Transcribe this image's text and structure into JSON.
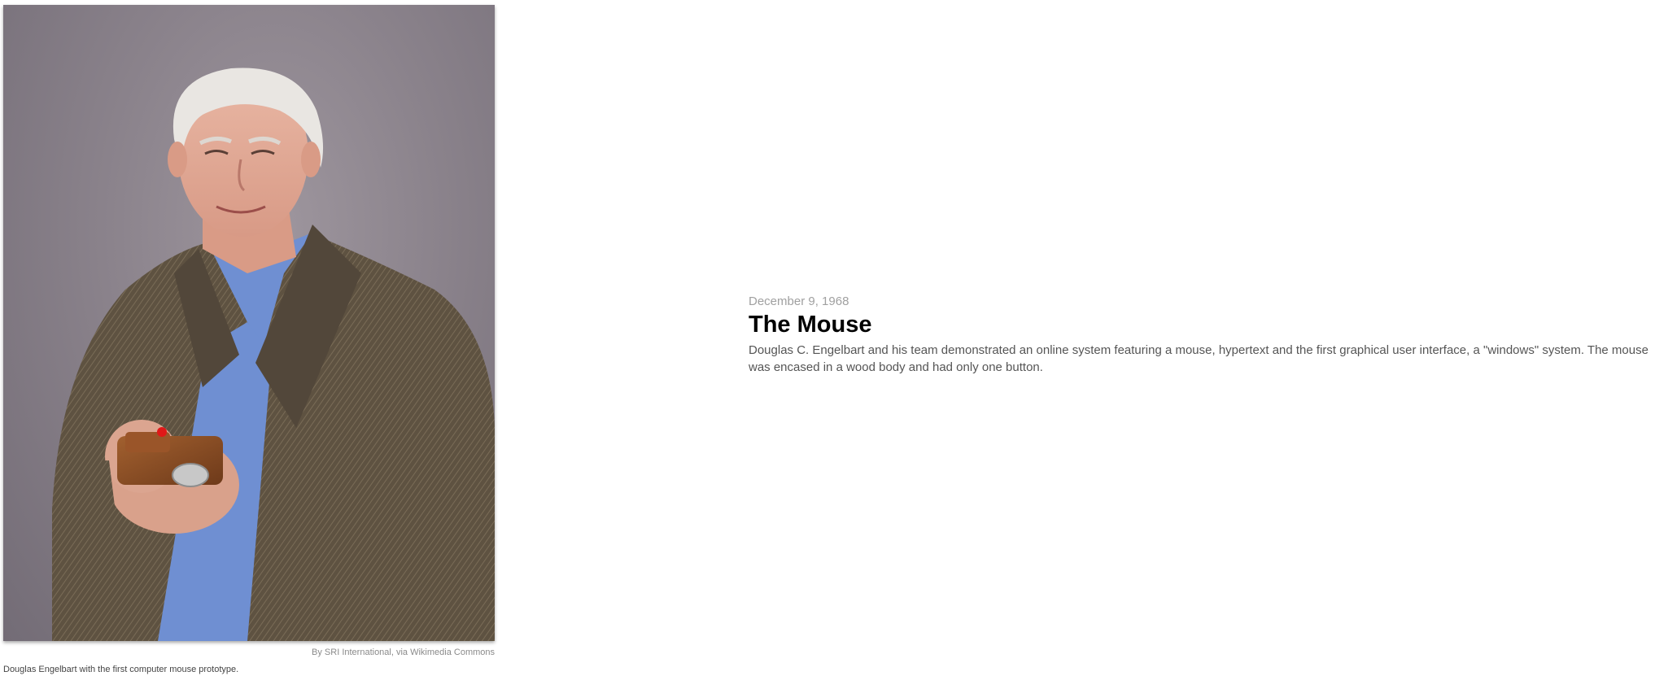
{
  "figure": {
    "photo_alt": "Douglas Engelbart holding the first computer mouse prototype",
    "credit": "By SRI International, via Wikimedia Commons",
    "caption": "Douglas Engelbart with the first computer mouse prototype."
  },
  "entry": {
    "date": "December 9, 1968",
    "title": "The Mouse",
    "body": "Douglas C. Engelbart and his team demonstrated an online system featuring a mouse, hypertext and the first graphical user interface, a \"windows\" system. The mouse was encased in a wood body and had only one button."
  },
  "colors": {
    "backdrop": "#8a828b",
    "jacket": "#5e5241",
    "shirt": "#6f8fd2",
    "mouse_wood": "#8a4a22",
    "mouse_button": "#e01818"
  }
}
